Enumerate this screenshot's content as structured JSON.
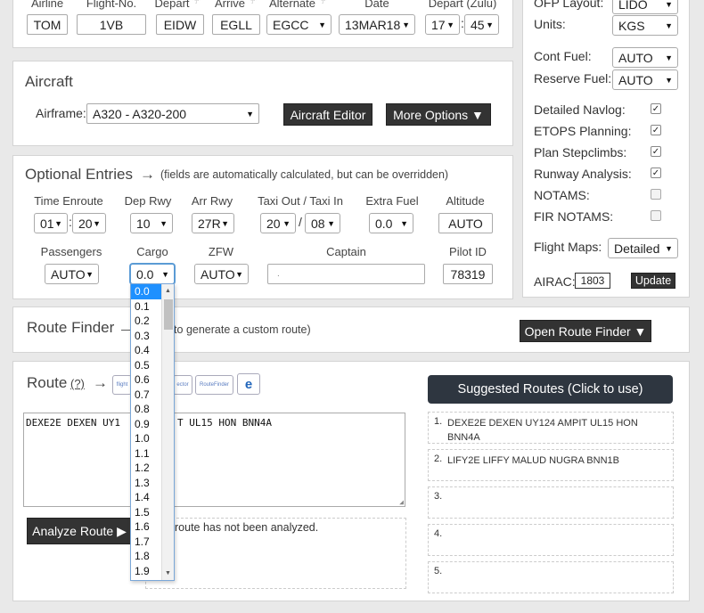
{
  "flight": {
    "airline_label": "Airline",
    "airline": "TOM",
    "flightno_label": "Flight-No.",
    "flightno": "1VB",
    "depart_label": "Depart",
    "depart": "EIDW",
    "arrive_label": "Arrive",
    "arrive": "EGLL",
    "alternate_label": "Alternate",
    "alternate": "EGCC",
    "date_label": "Date",
    "date": "13MAR18",
    "depart_zulu_label": "Depart (Zulu)",
    "depart_hh": "17",
    "depart_mm": "45"
  },
  "aircraft": {
    "title": "Aircraft",
    "airframe_label": "Airframe:",
    "airframe_value": "A320 - A320-200",
    "editor_button": "Aircraft Editor",
    "more_options_button": "More Options ▼"
  },
  "optional": {
    "title": "Optional Entries",
    "arrow": "→",
    "note": "(fields are automatically calculated, but can be overridden)",
    "time_enroute_label": "Time Enroute",
    "time_enroute_h": "01",
    "time_enroute_m": "20",
    "dep_rwy_label": "Dep Rwy",
    "dep_rwy": "10",
    "arr_rwy_label": "Arr Rwy",
    "arr_rwy": "27R",
    "taxi_label": "Taxi Out / Taxi In",
    "taxi_out": "20",
    "taxi_sep": "/",
    "taxi_in": "08",
    "extra_fuel_label": "Extra Fuel",
    "extra_fuel": "0.0",
    "altitude_label": "Altitude",
    "altitude": "AUTO",
    "passengers_label": "Passengers",
    "passengers": "AUTO",
    "cargo_label": "Cargo",
    "cargo": "0.0",
    "zfw_label": "ZFW",
    "zfw": "AUTO",
    "captain_label": "Captain",
    "captain": ".",
    "pilot_id_label": "Pilot ID",
    "pilot_id": "78319"
  },
  "route_finder": {
    "title": "Route Finder",
    "note_visible": "— his tool to generate a custom route)",
    "open_button": "Open Route Finder ▼"
  },
  "route": {
    "title": "Route",
    "help": "(?)",
    "arrow": "→",
    "icons": [
      "flight-icon",
      "vector-icon",
      "routefinder-icon",
      "e-icon"
    ],
    "icon_text": [
      "flight",
      "ector",
      "RouteFinder",
      "e"
    ],
    "text_left": "DEXE2E DEXEN UY1",
    "text_right": "T UL15 HON BNN4A",
    "analyze_button": "Analyze Route ▶",
    "analysis_status": "route has not been analyzed."
  },
  "suggested": {
    "title": "Suggested Routes (Click to use)",
    "items": [
      {
        "num": "1.",
        "text": "DEXE2E DEXEN UY124 AMPIT UL15 HON BNN4A"
      },
      {
        "num": "2.",
        "text": "LIFY2E LIFFY MALUD NUGRA BNN1B"
      },
      {
        "num": "3.",
        "text": ""
      },
      {
        "num": "4.",
        "text": ""
      },
      {
        "num": "5.",
        "text": ""
      }
    ]
  },
  "right": {
    "ofp_layout_label": "OFP Layout:",
    "ofp_layout": "LIDO",
    "units_label": "Units:",
    "units": "KGS",
    "cont_fuel_label": "Cont Fuel:",
    "cont_fuel": "AUTO",
    "reserve_fuel_label": "Reserve Fuel:",
    "reserve_fuel": "AUTO",
    "checks": [
      {
        "label": "Detailed Navlog:",
        "checked": true,
        "mark": "✓"
      },
      {
        "label": "ETOPS Planning:",
        "checked": true,
        "mark": "✓"
      },
      {
        "label": "Plan Stepclimbs:",
        "checked": true,
        "mark": "✓"
      },
      {
        "label": "Runway Analysis:",
        "checked": true,
        "mark": "✓"
      },
      {
        "label": "NOTAMS:",
        "checked": false,
        "mark": ""
      },
      {
        "label": "FIR NOTAMS:",
        "checked": false,
        "mark": ""
      }
    ],
    "flight_maps_label": "Flight Maps:",
    "flight_maps": "Detailed",
    "airac_label": "AIRAC:",
    "airac": "1803",
    "update_button": "Update"
  },
  "cargo_dropdown": {
    "options": [
      "0.0",
      "0.1",
      "0.2",
      "0.3",
      "0.4",
      "0.5",
      "0.6",
      "0.7",
      "0.8",
      "0.9",
      "1.0",
      "1.1",
      "1.2",
      "1.3",
      "1.4",
      "1.5",
      "1.6",
      "1.7",
      "1.8",
      "1.9"
    ],
    "selected": "0.0"
  },
  "colors": {
    "dark_button": "#333333",
    "selected_option": "#1e90ff",
    "suggested_header": "#2e3640"
  }
}
